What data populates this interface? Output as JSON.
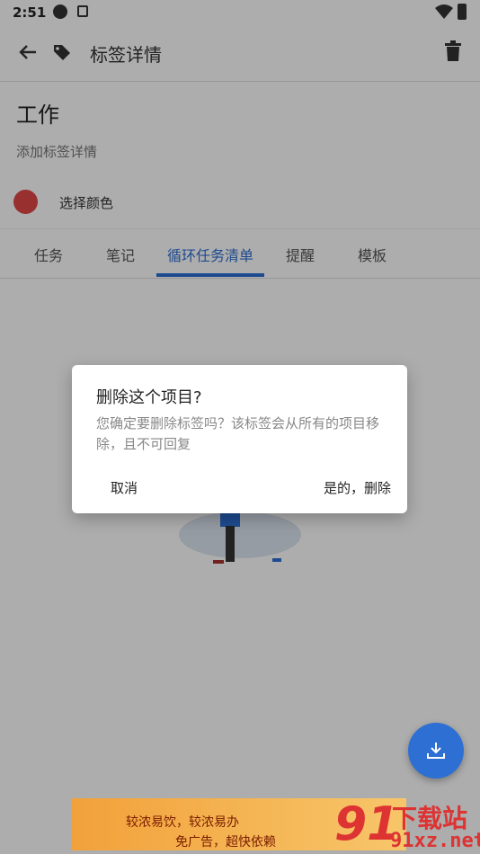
{
  "status": {
    "time": "2:51"
  },
  "toolbar": {
    "title": "标签详情"
  },
  "tag": {
    "name": "工作",
    "details_placeholder": "添加标签详情",
    "color_label": "选择颜色",
    "color": "#e04848"
  },
  "tabs": [
    {
      "label": "任务"
    },
    {
      "label": "笔记"
    },
    {
      "label": "循环任务清单"
    },
    {
      "label": "提醒"
    },
    {
      "label": "模板"
    }
  ],
  "dialog": {
    "title": "删除这个项目?",
    "message": "您确定要删除标签吗？该标签会从所有的项目移除，且不可回复",
    "cancel": "取消",
    "confirm": "是的，删除"
  },
  "ad": {
    "line1": "较浓易饮，较浓易办",
    "line2": "免广告，超快依赖"
  },
  "watermark": {
    "brand": "下载站",
    "url": "91xz.net",
    "logo": "91"
  },
  "colors": {
    "accent": "#2d6fd3",
    "tag_color": "#e04848"
  }
}
